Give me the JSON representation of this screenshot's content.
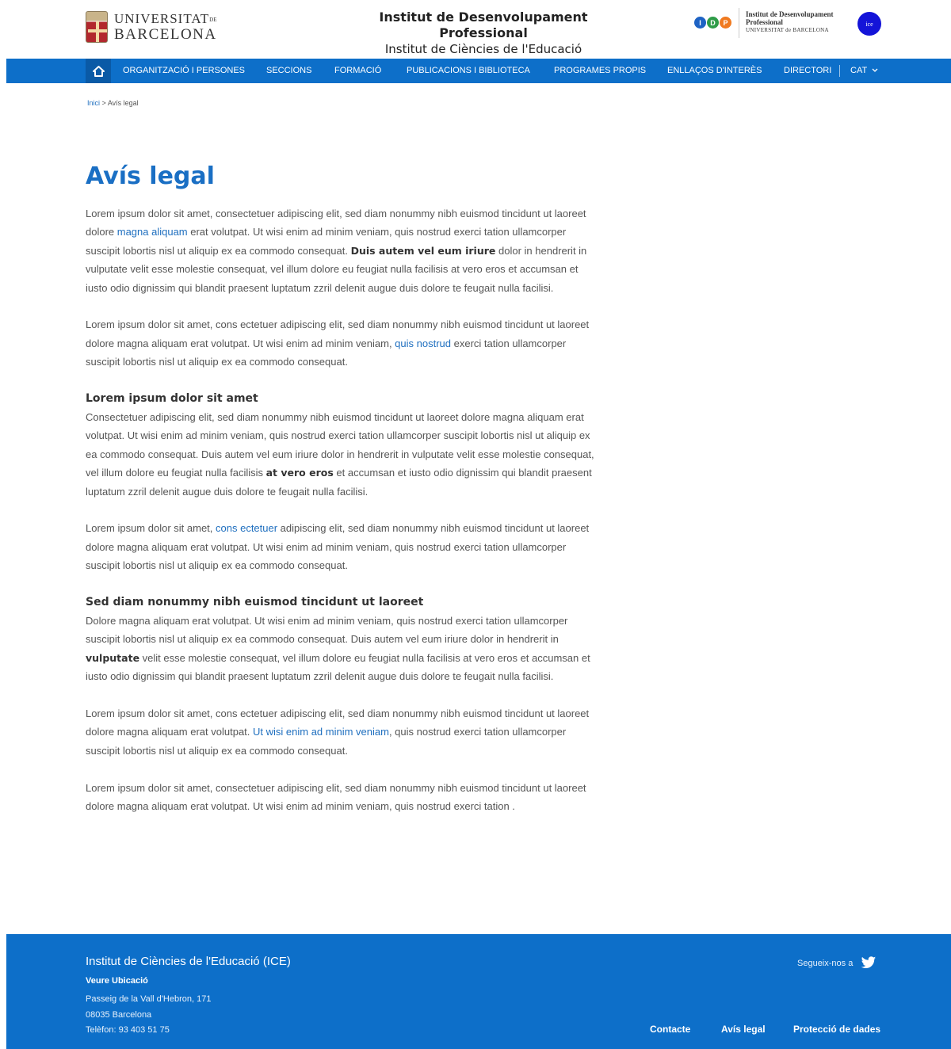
{
  "header": {
    "ub_logo": {
      "line1": "UNIVERSITAT",
      "line1_small": "DE",
      "line2": "BARCELONA"
    },
    "site_title": "Institut de Desenvolupament Professional",
    "site_subtitle": "Institut de Ciències de l'Educació",
    "idp_logo": {
      "letters": [
        "I",
        "D",
        "P"
      ],
      "text_line1": "Institut de Desenvolupament",
      "text_line2": "Professional",
      "text_line3": "UNIVERSITAT de BARCELONA"
    },
    "ice_logo": "ice"
  },
  "nav": {
    "home_icon": "home-icon",
    "items": [
      "ORGANITZACIÓ I PERSONES",
      "SECCIONS",
      "FORMACIÓ",
      "PUBLICACIONS I BIBLIOTECA",
      "PROGRAMES PROPIS",
      "ENLLAÇOS D'INTERÈS",
      "DIRECTORI"
    ],
    "language": "CAT"
  },
  "breadcrumb": {
    "home": "Inici",
    "separator": ">",
    "current": "Avís legal"
  },
  "page_title": "Avís legal",
  "content": {
    "p1": {
      "a": "Lorem ipsum dolor sit amet, consectetuer adipiscing elit, sed diam nonummy nibh euismod tincidunt ut laoreet dolore ",
      "link": "magna aliquam",
      "b": " erat volutpat. Ut wisi enim ad minim veniam, quis nostrud exerci tation ullamcorper suscipit lobortis nisl ut aliquip ex ea commodo consequat. ",
      "bold": "Duis autem vel eum iriure",
      "c": " dolor in hendrerit in vulputate velit esse molestie consequat, vel illum dolore eu feugiat nulla facilisis at vero eros et accumsan et iusto odio dignissim qui blandit praesent luptatum zzril delenit augue duis dolore te feugait nulla facilisi."
    },
    "p2": {
      "a": "Lorem ipsum dolor sit amet, cons ectetuer adipiscing elit, sed diam nonummy nibh euismod tincidunt ut laoreet dolore magna aliquam erat volutpat. Ut wisi enim ad minim veniam, ",
      "link": "quis nostrud",
      "b": " exerci tation ullamcorper suscipit lobortis nisl ut aliquip ex ea commodo consequat."
    },
    "h1": "Lorem ipsum dolor sit amet",
    "p3": {
      "a": "Consectetuer adipiscing elit, sed diam nonummy nibh euismod tincidunt ut laoreet dolore magna aliquam erat volutpat. Ut wisi enim ad minim veniam, quis nostrud exerci tation ullamcorper suscipit lobortis nisl ut aliquip ex ea commodo consequat. Duis autem vel eum iriure dolor in hendrerit in vulputate velit esse molestie consequat, vel illum dolore eu feugiat nulla facilisis ",
      "bold": "at vero eros",
      "b": " et accumsan et iusto odio dignissim qui blandit praesent luptatum zzril delenit augue duis dolore te feugait nulla facilisi."
    },
    "p4": {
      "a": "Lorem ipsum dolor sit amet, ",
      "link": "cons ectetuer",
      "b": " adipiscing elit, sed diam nonummy nibh euismod tincidunt ut laoreet dolore magna aliquam erat volutpat. Ut wisi enim ad minim veniam, quis nostrud exerci tation ullamcorper suscipit lobortis nisl ut aliquip ex ea commodo consequat."
    },
    "h2": "Sed diam nonummy nibh euismod tincidunt ut laoreet",
    "p5": {
      "a": "Dolore magna aliquam erat volutpat. Ut wisi enim ad minim veniam, quis nostrud exerci tation ullamcorper suscipit lobortis nisl ut aliquip ex ea commodo consequat. Duis autem vel eum iriure dolor in hendrerit in ",
      "bold": "vulputate",
      "b": " velit esse molestie consequat, vel illum dolore eu feugiat nulla facilisis at vero eros et accumsan et iusto odio dignissim qui blandit praesent luptatum zzril delenit augue duis dolore te feugait nulla facilisi."
    },
    "p6": {
      "a": "Lorem ipsum dolor sit amet, cons ectetuer adipiscing elit, sed diam nonummy nibh euismod tincidunt ut laoreet dolore magna aliquam erat volutpat. ",
      "link": "Ut wisi enim ad minim veniam",
      "b": ", quis nostrud exerci tation ullamcorper suscipit lobortis nisl ut aliquip ex ea commodo consequat."
    },
    "p7": "Lorem ipsum dolor sit amet, consectetuer adipiscing elit, sed diam nonummy nibh euismod tincidunt ut laoreet dolore magna aliquam erat volutpat. Ut wisi enim ad minim veniam, quis nostrud exerci tation ."
  },
  "footer": {
    "org": "Institut de Ciències de l'Educació (ICE)",
    "location_link": "Veure Ubicació",
    "address1": "Passeig de la Vall d'Hebron, 171",
    "address2": "08035 Barcelona",
    "phone": "Telèfon: 93 403 51 75",
    "follow": "Segueix-nos a",
    "links": [
      "Contacte",
      "Avís legal",
      "Protecció de dades"
    ]
  },
  "colors": {
    "brand_blue": "#0d6fc9",
    "title_blue": "#1a6fc4",
    "link_blue": "#1f6fbf"
  }
}
